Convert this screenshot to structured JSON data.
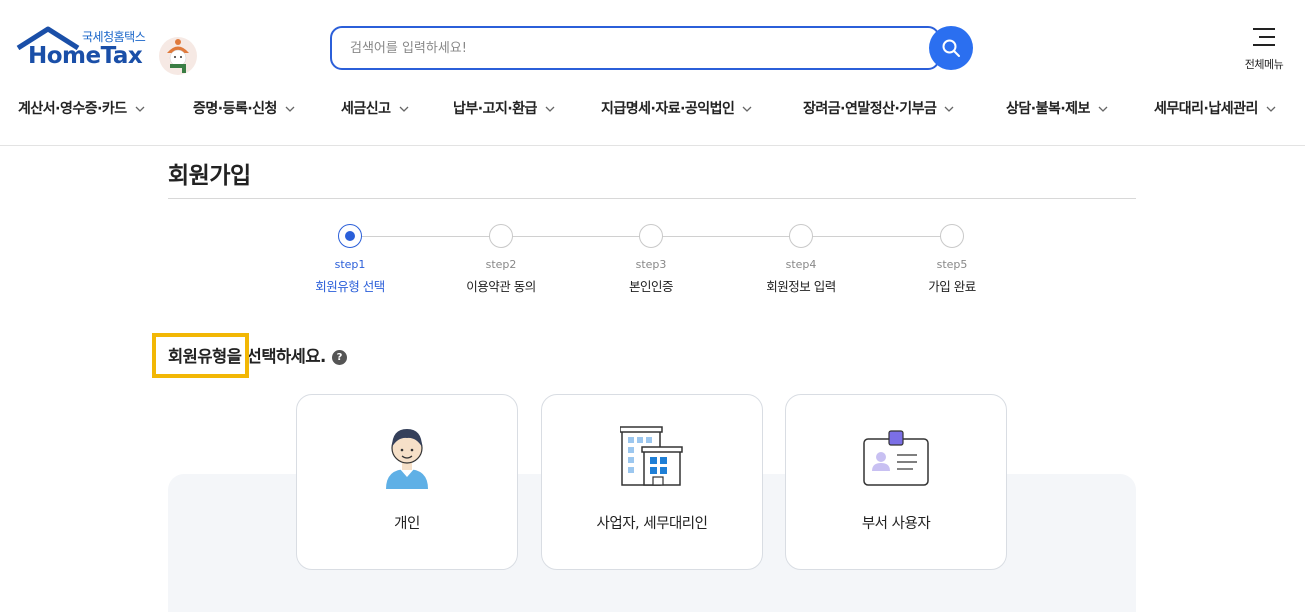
{
  "header": {
    "logo_small": "국세청홈택스",
    "logo_big": "HomeTax",
    "search_placeholder": "검색어를 입력하세요!",
    "all_menu_label": "전체메뉴"
  },
  "nav": {
    "items": [
      "계산서·영수증·카드",
      "증명·등록·신청",
      "세금신고",
      "납부·고지·환급",
      "지급명세·자료·공익법인",
      "장려금·연말정산·기부금",
      "상담·불복·제보",
      "세무대리·납세관리"
    ]
  },
  "page": {
    "title": "회원가입"
  },
  "steps": [
    {
      "num": "step1",
      "name": "회원유형 선택",
      "active": true
    },
    {
      "num": "step2",
      "name": "이용약관 동의",
      "active": false
    },
    {
      "num": "step3",
      "name": "본인인증",
      "active": false
    },
    {
      "num": "step4",
      "name": "회원정보 입력",
      "active": false
    },
    {
      "num": "step5",
      "name": "가입 완료",
      "active": false
    }
  ],
  "select_section": {
    "title": "회원유형을 선택하세요.",
    "help": "?"
  },
  "cards": [
    {
      "label": "개인",
      "icon": "person-icon"
    },
    {
      "label": "사업자, 세무대리인",
      "icon": "building-icon"
    },
    {
      "label": "부서 사용자",
      "icon": "id-badge-icon"
    }
  ],
  "colors": {
    "primary": "#2b5fd9",
    "highlight": "#f2b705",
    "logo_blue": "#1a4fa8"
  }
}
